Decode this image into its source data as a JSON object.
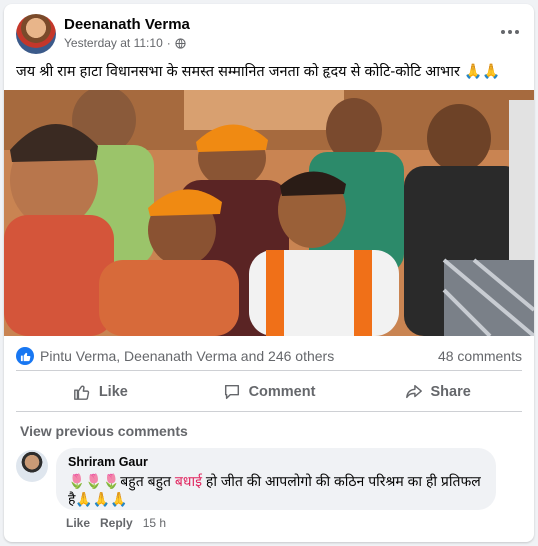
{
  "post": {
    "author": "Deenanath Verma",
    "time": "Yesterday at 11:10",
    "separator": "·",
    "text": "जय श्री राम हाटा विधानसभा के समस्त सम्मानित जनता को हृदय से कोटि-कोटि आभार 🙏🙏"
  },
  "reactions": {
    "summary": "Pintu Verma, Deenanath Verma and 246 others",
    "comments": "48 comments"
  },
  "actions": {
    "like": "Like",
    "comment": "Comment",
    "share": "Share"
  },
  "comments": {
    "view_previous": "View previous comments",
    "items": [
      {
        "author": "Shriram Gaur",
        "text_before": "🌷🌷🌷बहुत बहुत ",
        "highlight": "बधाई",
        "text_after": " हो जीत की आपलोगो की कठिन परिश्रम का ही प्रतिफल है🙏🙏🙏",
        "like": "Like",
        "reply": "Reply",
        "age": "15 h"
      }
    ]
  },
  "colors": {
    "accent": "#1877f2",
    "secondary_text": "#65676b",
    "highlight": "#e0245e"
  },
  "icons": [
    "more-options-icon",
    "globe-icon",
    "like-reaction-icon",
    "thumbs-up-icon",
    "comment-icon",
    "share-icon"
  ]
}
